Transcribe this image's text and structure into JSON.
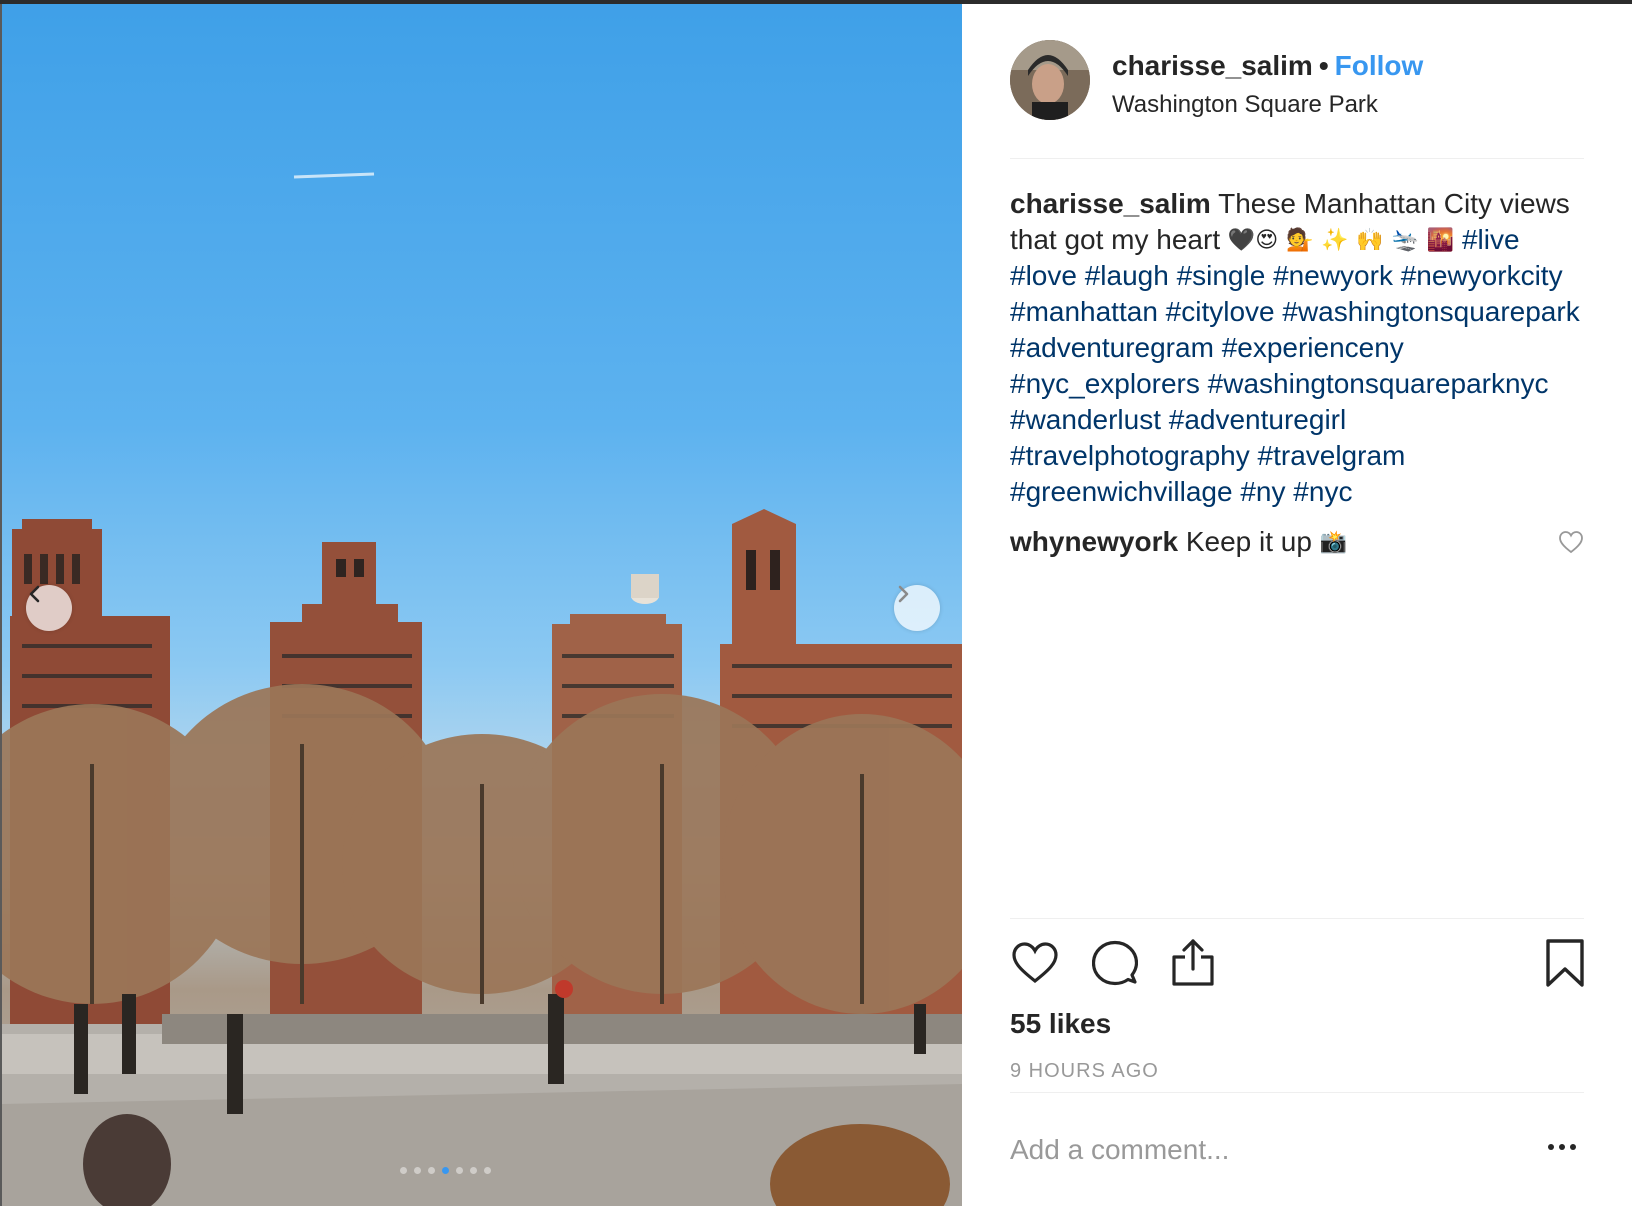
{
  "post": {
    "username": "charisse_salim",
    "separator": "•",
    "follow_label": "Follow",
    "location": "Washington Square Park"
  },
  "caption": {
    "author": "charisse_salim",
    "text_before_emoji": "These Manhattan City views that got my heart",
    "emoji": [
      "🖤",
      "😍",
      "💁",
      "✨",
      "🙌",
      "🛬",
      "🌇"
    ],
    "hashtags": [
      "#live",
      "#love",
      "#laugh",
      "#single",
      "#newyork",
      "#newyorkcity",
      "#manhattan",
      "#citylove",
      "#washingtonsquarepark",
      "#adventuregram",
      "#experienceny",
      "#nyc_explorers",
      "#washingtonsquareparknyc",
      "#wanderlust",
      "#adventuregirl",
      "#travelphotography",
      "#travelgram",
      "#greenwichvillage",
      "#ny",
      "#nyc"
    ]
  },
  "comments": [
    {
      "author": "whynewyork",
      "text": "Keep it up",
      "emoji": "📸"
    }
  ],
  "stats": {
    "likes": "55 likes",
    "time": "9 HOURS AGO"
  },
  "composer": {
    "placeholder": "Add a comment..."
  },
  "carousel": {
    "total_slides": 7,
    "active_slide": 3
  },
  "icons": {
    "like": "heart-icon",
    "comment": "speech-bubble-icon",
    "share": "share-icon",
    "save": "bookmark-icon",
    "more": "more-options-icon",
    "prev": "chevron-left-icon",
    "next": "chevron-right-icon"
  },
  "colors": {
    "link_blue": "#3897f0",
    "hashtag": "#003569",
    "text": "#262626",
    "muted": "#999999"
  }
}
